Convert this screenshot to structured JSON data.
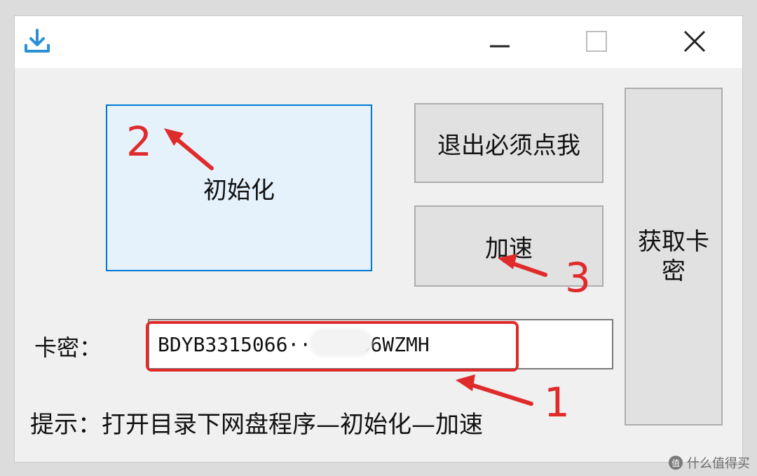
{
  "window": {
    "app_icon": "download-icon",
    "controls": {
      "minimize_icon": "minimize-icon",
      "maximize_icon": "maximize-icon",
      "close_icon": "close-icon"
    }
  },
  "buttons": {
    "init_label": "初始化",
    "exit_label": "退出必须点我",
    "speed_label": "加速",
    "getkey_label": "获取卡密"
  },
  "key_field": {
    "label": "卡密：",
    "value": "BDYB3315066····8886WZMH"
  },
  "hint": "提示：打开目录下网盘程序—初始化—加速",
  "annotations": {
    "n1": "1",
    "n2": "2",
    "n3": "3",
    "color": "#e02b2b"
  },
  "watermark": {
    "logo": "值",
    "text": "什么值得买"
  }
}
